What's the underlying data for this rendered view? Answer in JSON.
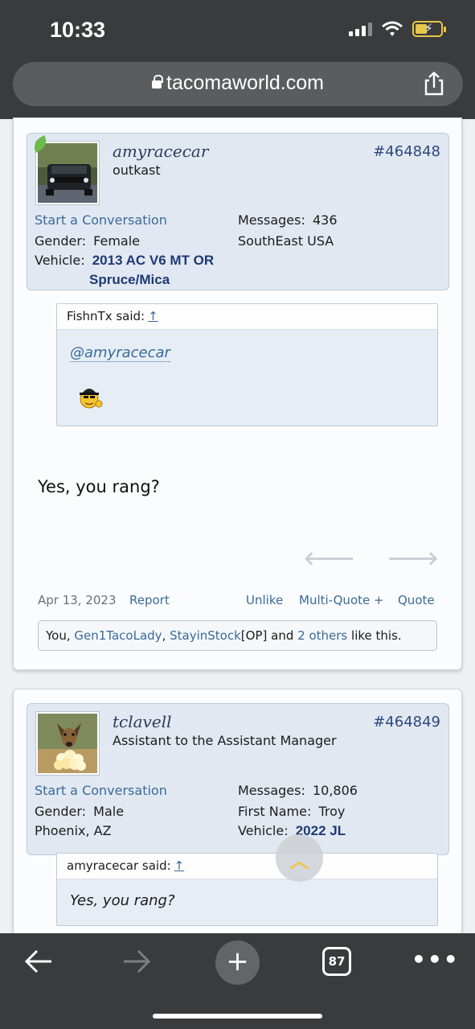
{
  "status": {
    "time": "10:33"
  },
  "browser": {
    "url": "tacomaworld.com",
    "tab_count": "87"
  },
  "posts": [
    {
      "username": "amyracecar",
      "user_title": "outkast",
      "post_number": "#464848",
      "start_conversation": "Start a Conversation",
      "gender_label": "Gender:",
      "gender": "Female",
      "vehicle_label": "Vehicle:",
      "vehicle_line1": "2013 AC V6 MT OR",
      "vehicle_line2": "Spruce/Mica",
      "messages_label": "Messages:",
      "messages": "436",
      "location": "SouthEast USA",
      "quote_author": "FishnTx said:",
      "quote_arrow": "↑",
      "quote_mention": "@amyracecar",
      "message": "Yes, you rang?",
      "date": "Apr 13, 2023",
      "report": "Report",
      "unlike": "Unlike",
      "multi_quote": "Multi-Quote +",
      "quote": "Quote",
      "likes": {
        "you": "You,",
        "user1": "Gen1TacoLady",
        "sep1": ",",
        "user2": "StayinStock",
        "op": "[OP]",
        "and": "and",
        "others": "2 others",
        "suffix": "like this."
      }
    },
    {
      "username": "tclavell",
      "user_title": "Assistant to the Assistant Manager",
      "post_number": "#464849",
      "start_conversation": "Start a Conversation",
      "gender_label": "Gender:",
      "gender": "Male",
      "location": "Phoenix, AZ",
      "messages_label": "Messages:",
      "messages": "10,806",
      "first_name_label": "First Name:",
      "first_name": "Troy",
      "vehicle_label": "Vehicle:",
      "vehicle": "2022 JL",
      "quote_author": "amyracecar said:",
      "quote_arrow": "↑",
      "quote_text": "Yes, you rang?"
    }
  ],
  "icons": {
    "share": "share-icon",
    "back": "back-arrow-icon",
    "forward": "forward-arrow-icon",
    "new_tab": "plus-icon",
    "more": "more-icon",
    "scroll_top": "chevron-up-icon"
  }
}
